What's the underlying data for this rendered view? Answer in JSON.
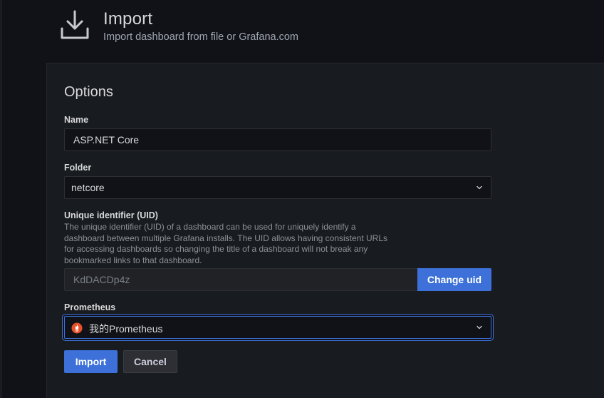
{
  "header": {
    "title": "Import",
    "subtitle": "Import dashboard from file or Grafana.com",
    "icon": "import-download-icon"
  },
  "options": {
    "title": "Options",
    "name": {
      "label": "Name",
      "value": "ASP.NET Core"
    },
    "folder": {
      "label": "Folder",
      "value": "netcore",
      "icon": "chevron-down-icon"
    },
    "uid": {
      "label": "Unique identifier (UID)",
      "description_lines": [
        "The unique identifier (UID) of a dashboard can be used for uniquely identify a",
        "dashboard between multiple Grafana installs. The UID allows having consistent URLs",
        "for accessing dashboards so changing the title of a dashboard will not break any",
        "bookmarked links to that dashboard."
      ],
      "value": "KdDACDp4z",
      "change_button": "Change uid"
    },
    "prometheus": {
      "label": "Prometheus",
      "value": "我的Prometheus",
      "icon": "prometheus-icon",
      "icon_color": "#e6522c"
    }
  },
  "actions": {
    "import_label": "Import",
    "cancel_label": "Cancel"
  },
  "colors": {
    "accent": "#3d71d9",
    "background": "#111217",
    "panel": "#181b1f"
  }
}
